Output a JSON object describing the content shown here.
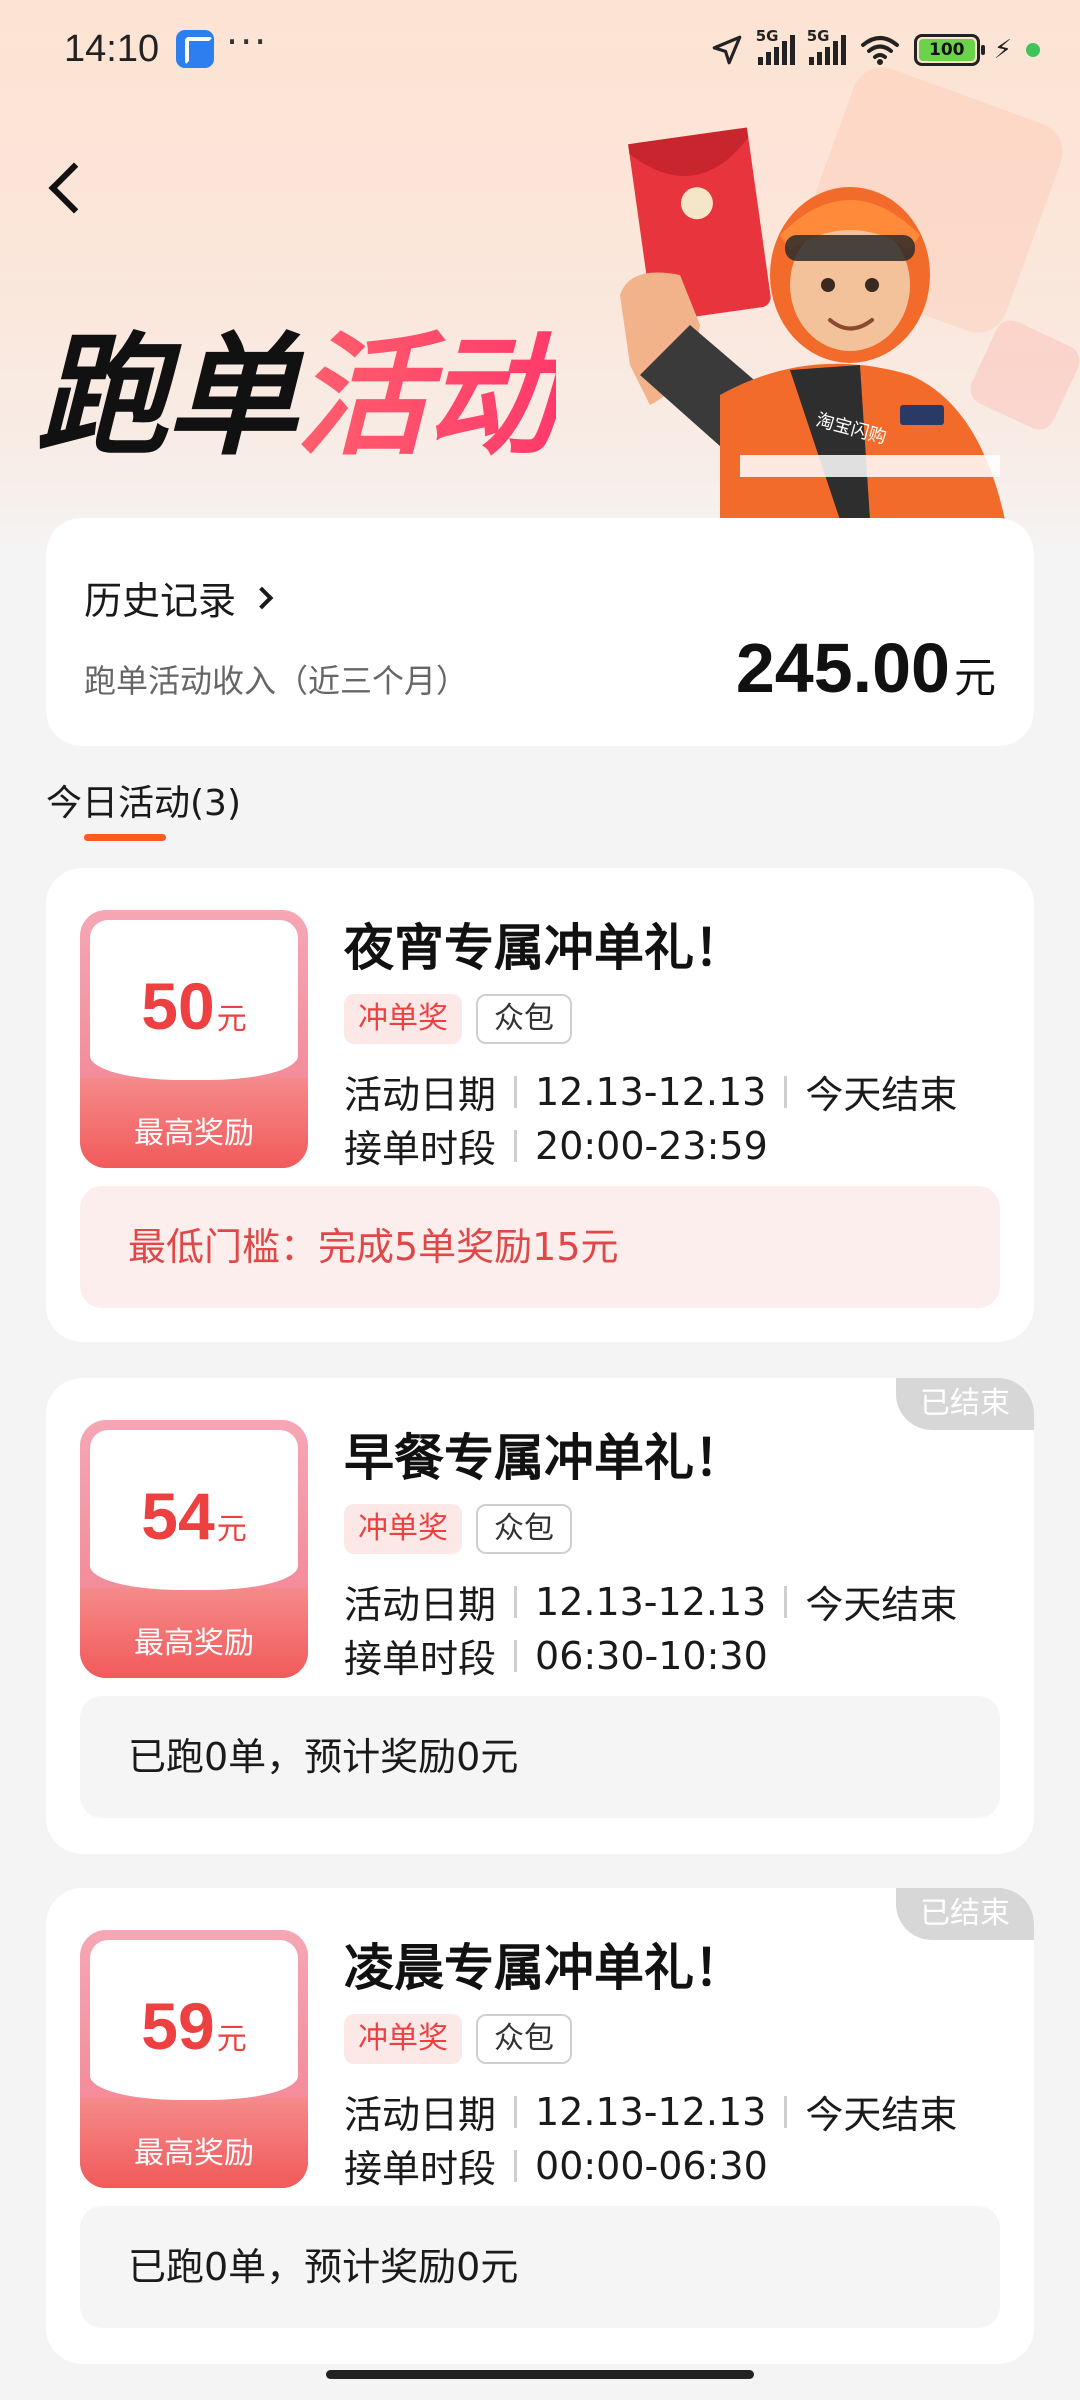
{
  "status_bar": {
    "time": "14:10",
    "dots": "···",
    "sig1_label": "5G",
    "sig2_label": "5G",
    "battery": "100"
  },
  "header": {
    "title_part1": "跑单",
    "title_part2": "活动"
  },
  "summary": {
    "history_label": "历史记录",
    "income_label": "跑单活动收入（近三个月）",
    "income_value": "245.00",
    "income_unit": "元"
  },
  "tab": {
    "label": "今日活动(3)"
  },
  "activities": [
    {
      "amount": "50",
      "unit": "元",
      "amount_label": "最高奖励",
      "title": "夜宵专属冲单礼！",
      "tag1": "冲单奖",
      "tag2": "众包",
      "date_label": "活动日期",
      "date_value": "12.13-12.13",
      "end_text": "今天结束",
      "time_label": "接单时段",
      "time_value": "20:00-23:59",
      "info": "最低门槛：完成5单奖励15元",
      "ended": ""
    },
    {
      "amount": "54",
      "unit": "元",
      "amount_label": "最高奖励",
      "title": "早餐专属冲单礼！",
      "tag1": "冲单奖",
      "tag2": "众包",
      "date_label": "活动日期",
      "date_value": "12.13-12.13",
      "end_text": "今天结束",
      "time_label": "接单时段",
      "time_value": "06:30-10:30",
      "info": "已跑0单，预计奖励0元",
      "ended": "已结束"
    },
    {
      "amount": "59",
      "unit": "元",
      "amount_label": "最高奖励",
      "title": "凌晨专属冲单礼！",
      "tag1": "冲单奖",
      "tag2": "众包",
      "date_label": "活动日期",
      "date_value": "12.13-12.13",
      "end_text": "今天结束",
      "time_label": "接单时段",
      "time_value": "00:00-06:30",
      "info": "已跑0单，预计奖励0元",
      "ended": "已结束"
    }
  ],
  "colors": {
    "accent": "#ee4040",
    "tab_underline": "#ff5a1f",
    "courier_jacket": "#f26b2a"
  },
  "illustration": {
    "courier_chest_text": "淘宝闪购"
  }
}
